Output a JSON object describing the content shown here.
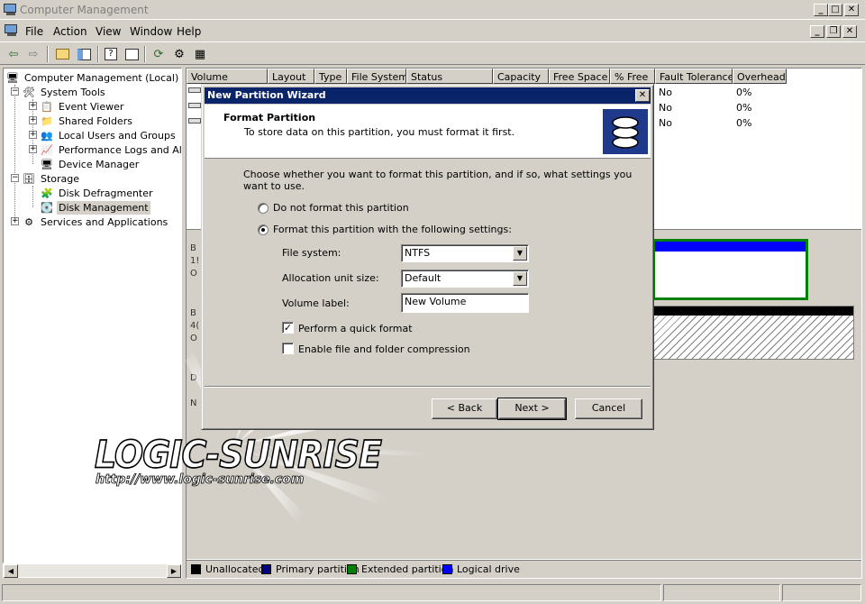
{
  "window": {
    "title": "Computer Management"
  },
  "menu": [
    "File",
    "Action",
    "View",
    "Window",
    "Help"
  ],
  "tree": {
    "root": "Computer Management (Local)",
    "system_tools": "System Tools",
    "event_viewer": "Event Viewer",
    "shared_folders": "Shared Folders",
    "local_users": "Local Users and Groups",
    "perf_logs": "Performance Logs and Alerts",
    "device_manager": "Device Manager",
    "storage": "Storage",
    "disk_defrag": "Disk Defragmenter",
    "disk_mgmt": "Disk Management",
    "services": "Services and Applications"
  },
  "volume_list": {
    "columns": [
      "Volume",
      "Layout",
      "Type",
      "File System",
      "Status",
      "Capacity",
      "Free Space",
      "% Free",
      "Fault Tolerance",
      "Overhead"
    ],
    "rows": [
      {
        "fault_tolerance": "No",
        "overhead": "0%"
      },
      {
        "fault_tolerance": "No",
        "overhead": "0%"
      },
      {
        "fault_tolerance": "No",
        "overhead": "0%"
      }
    ]
  },
  "disks_partial": {
    "d0": [
      "B",
      "1!",
      "O"
    ],
    "d1": [
      "B",
      "4(",
      "O"
    ],
    "d2": [
      "D",
      "N"
    ]
  },
  "legend": {
    "unallocated": "Unallocated",
    "primary": "Primary partition",
    "extended": "Extended partition",
    "logical": "Logical drive",
    "colors": {
      "unallocated": "#000000",
      "primary": "#000080",
      "extended": "#008000",
      "logical": "#0000ff"
    }
  },
  "dialog": {
    "title": "New Partition Wizard",
    "heading": "Format Partition",
    "subheading": "To store data on this partition, you must format it first.",
    "intro": "Choose whether you want to format this partition, and if so, what settings you want to use.",
    "option_no_format": "Do not format this partition",
    "option_format": "Format this partition with the following settings:",
    "fs_label": "File system:",
    "fs_value": "NTFS",
    "alloc_label": "Allocation unit size:",
    "alloc_value": "Default",
    "vol_label": "Volume label:",
    "vol_value": "New Volume",
    "quick_format": "Perform a quick format",
    "compression": "Enable file and folder compression",
    "back": "< Back",
    "next": "Next >",
    "cancel": "Cancel"
  },
  "watermark": {
    "brand": "LOGIC-SUNRISE",
    "url": "http://www.logic-sunrise.com"
  }
}
